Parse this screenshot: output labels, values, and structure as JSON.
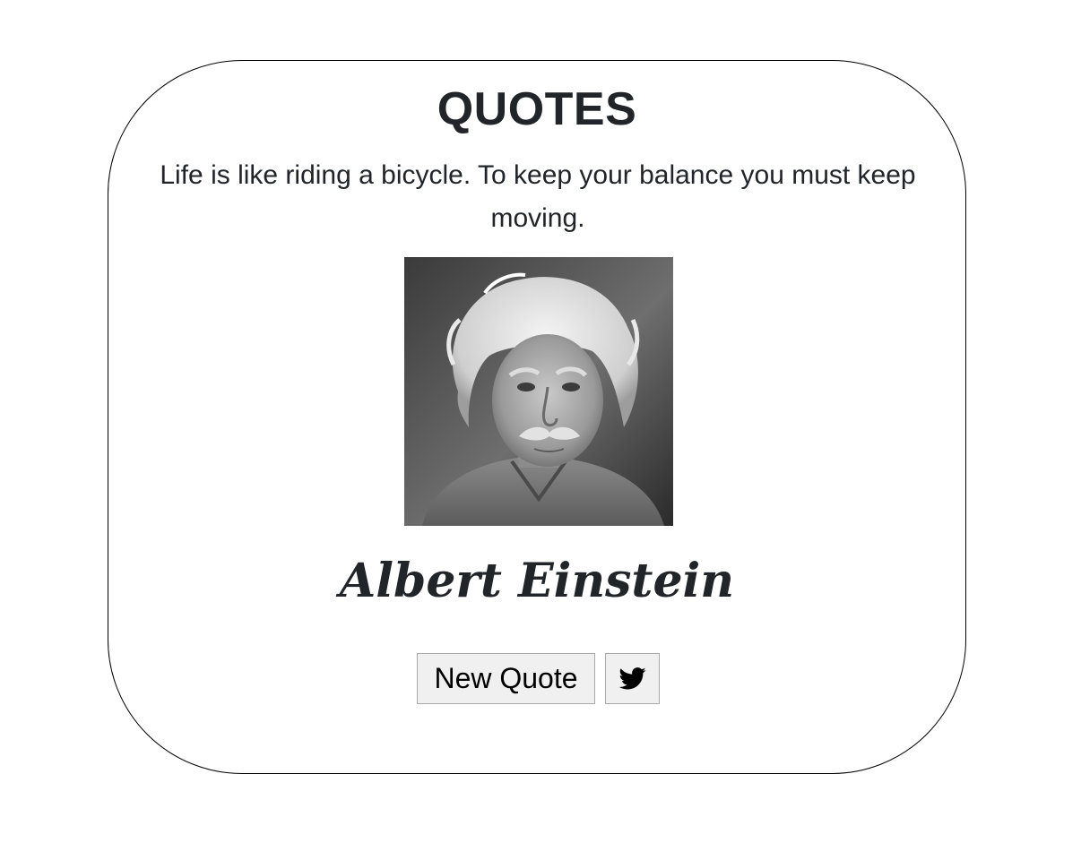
{
  "header": {
    "title": "QUOTES"
  },
  "quote": {
    "text": "Life is like riding a bicycle. To keep your balance you must keep moving.",
    "author": "Albert Einstein",
    "portrait_image": "albert-einstein-portrait"
  },
  "actions": {
    "new_quote_label": "New Quote",
    "tweet_icon": "twitter-bird-icon"
  },
  "colors": {
    "text": "#212529",
    "card_border": "#000000",
    "button_bg": "#f0f0f0",
    "button_border": "#a9a9a9"
  }
}
